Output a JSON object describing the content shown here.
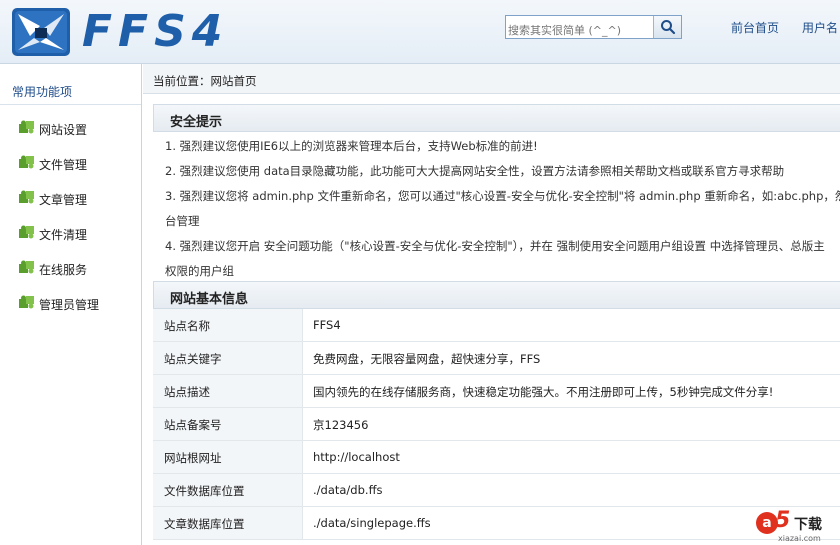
{
  "header": {
    "brand": "FFS4",
    "search_placeholder": "搜索其实很简单 (^_^)",
    "nav": [
      "前台首页",
      "用户名"
    ]
  },
  "sidebar": {
    "title": "常用功能项",
    "items": [
      {
        "label": "网站设置"
      },
      {
        "label": "文件管理"
      },
      {
        "label": "文章管理"
      },
      {
        "label": "文件清理"
      },
      {
        "label": "在线服务"
      },
      {
        "label": "管理员管理"
      }
    ]
  },
  "breadcrumb": "当前位置：网站首页",
  "security": {
    "title": "安全提示",
    "lines": [
      "1. 强烈建议您使用IE6以上的浏览器来管理本后台，支持Web标准的前进!",
      "2. 强烈建议您使用 data目录隐藏功能，此功能可大大提高网站安全性，设置方法请参照相关帮助文档或联系官方寻求帮助",
      "3. 强烈建议您将 admin.php 文件重新命名，您可以通过\"核心设置-安全与优化-安全控制\"将 admin.php 重新命名，如:abc.php，然",
      "台管理",
      "4. 强烈建议您开启 安全问题功能（\"核心设置-安全与优化-安全控制\"），并在 强制使用安全问题用户组设置 中选择管理员、总版主",
      "权限的用户组"
    ]
  },
  "site_info": {
    "title": "网站基本信息",
    "rows": [
      {
        "key": "站点名称",
        "value": "FFS4"
      },
      {
        "key": "站点关键字",
        "value": "免费网盘，无限容量网盘，超快速分享，FFS"
      },
      {
        "key": "站点描述",
        "value": "国内领先的在线存储服务商，快速稳定功能强大。不用注册即可上传，5秒钟完成文件分享!"
      },
      {
        "key": "站点备案号",
        "value": "京123456"
      },
      {
        "key": "网站根网址",
        "value": "http://localhost"
      },
      {
        "key": "文件数据库位置",
        "value": "./data/db.ffs"
      },
      {
        "key": "文章数据库位置",
        "value": "./data/singlepage.ffs"
      }
    ]
  },
  "watermark": {
    "mark": "a",
    "digit": "5",
    "text": "下载",
    "url": "xiazai.com"
  },
  "colors": {
    "accent": "#1f5ea8",
    "link": "#1f4d8a",
    "icon_green": "#5a9e2e",
    "watermark_red": "#e0311f"
  }
}
